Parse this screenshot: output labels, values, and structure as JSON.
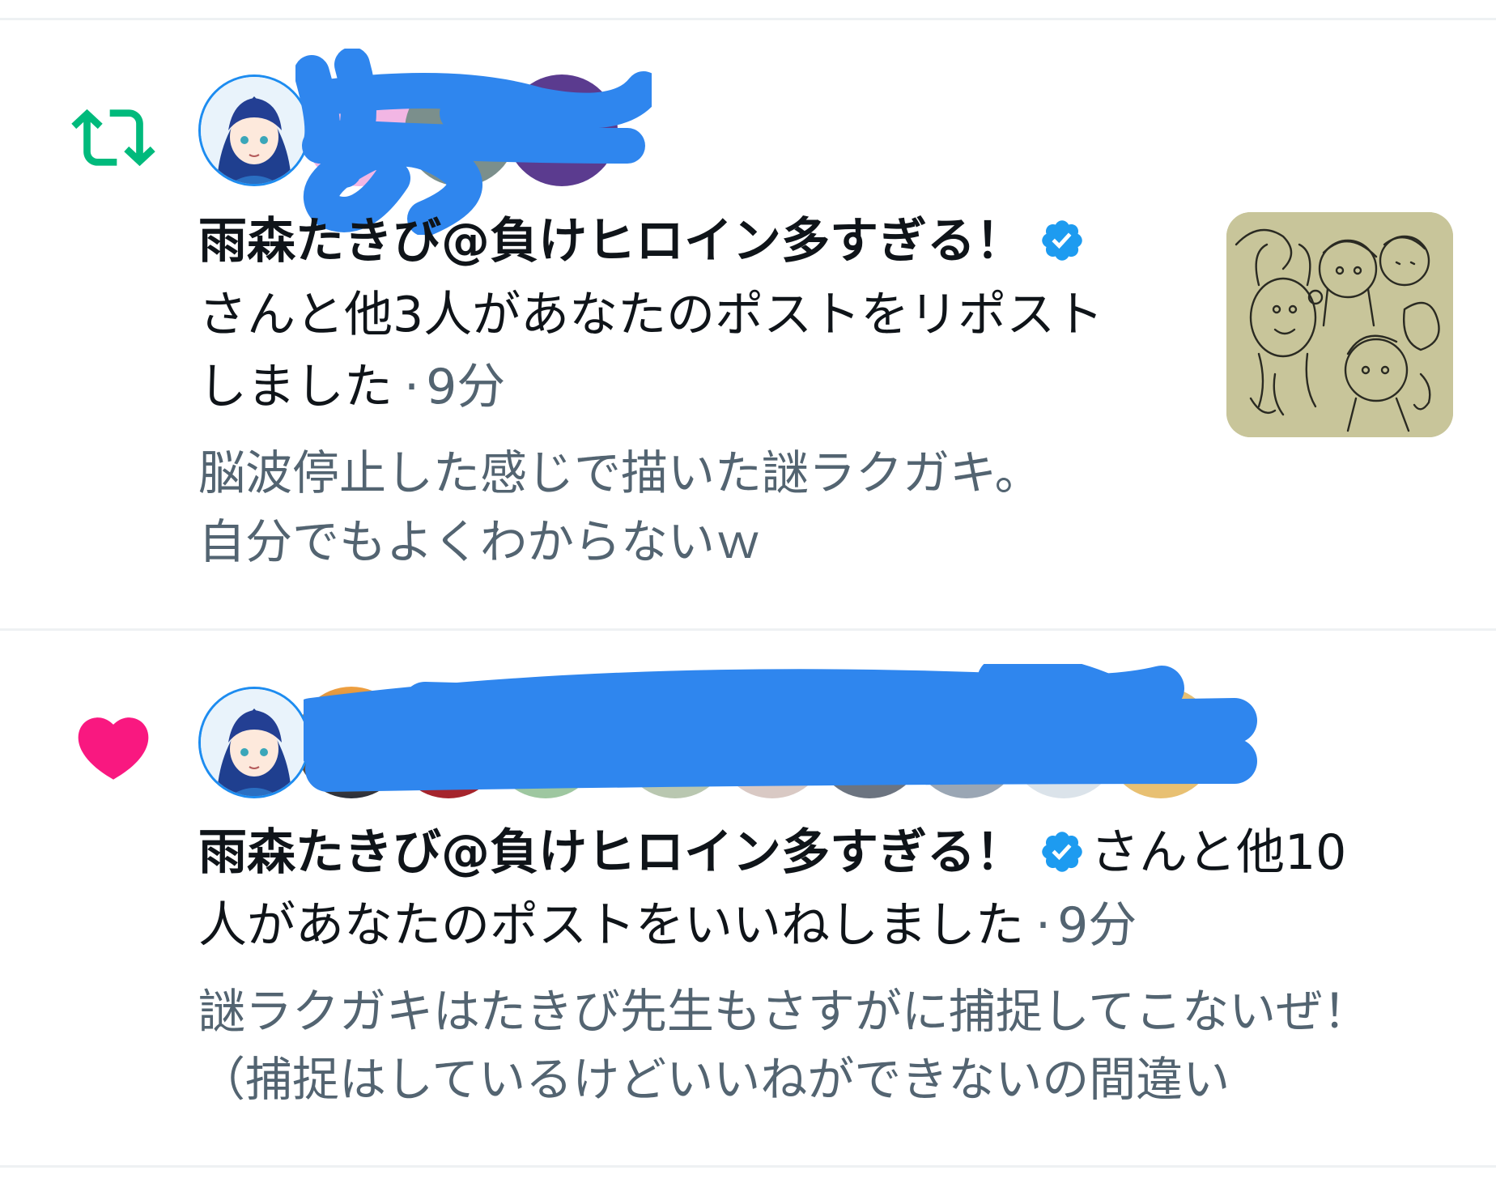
{
  "notifications": [
    {
      "kind": "repost",
      "icon": "repost-icon",
      "icon_color": "#00ba7c",
      "user_name": "雨森たきび@負けヒロイン多すぎる！",
      "action_line_1": "さんと他3人があなたのポストをリポスト",
      "action_line_2": "しました",
      "separator": "·",
      "time": "9分",
      "post_lines": [
        "脳波停止した感じで描いた謎ラクガキ。",
        "自分でもよくわからないｗ"
      ],
      "has_thumbnail": true
    },
    {
      "kind": "like",
      "icon": "heart-icon",
      "icon_color": "#f91880",
      "user_name": "雨森たきび@負けヒロイン多すぎる！",
      "action_line_1_suffix": "さんと他10",
      "action_line_2": "人があなたのポストをいいねしました",
      "separator": "·",
      "time": "9分",
      "post_lines": [
        "謎ラクガキはたきび先生もさすがに捕捉してこないぜ！",
        "（捕捉はしているけどいいねができないの間違い"
      ]
    }
  ],
  "colors": {
    "verified": "#1d9bf0",
    "redaction": "#2f86ee",
    "divider": "#eef1f3"
  }
}
